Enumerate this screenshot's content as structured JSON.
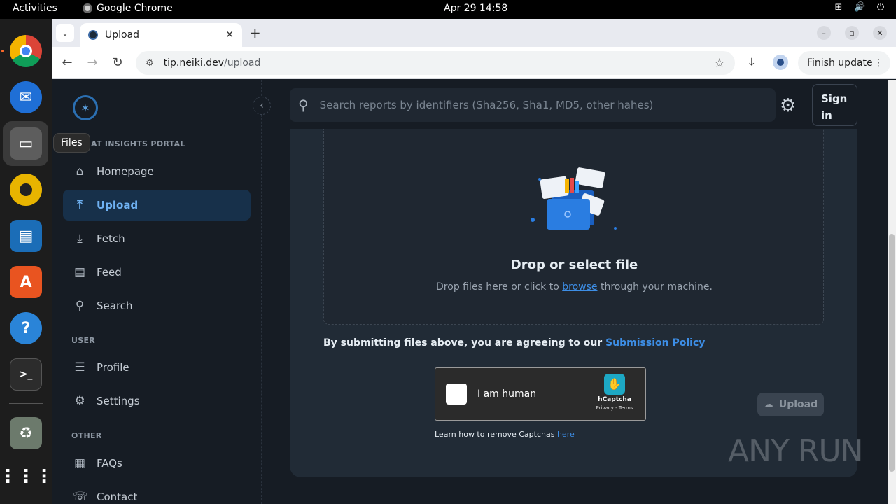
{
  "topbar": {
    "activities": "Activities",
    "app_name": "Google Chrome",
    "clock": "Apr 29  14:58"
  },
  "dock": {
    "items": [
      "chrome-icon",
      "thunderbird-icon",
      "files-icon",
      "rhythmbox-icon",
      "writer-icon",
      "app-center-icon",
      "help-icon",
      "terminal-icon",
      "trash-icon",
      "app-grid-icon"
    ],
    "tooltip": "Files"
  },
  "browser": {
    "tab_title": "Upload",
    "url_host": "tip.neiki.dev",
    "url_path": "/upload",
    "finish_update": "Finish update"
  },
  "sidebar": {
    "brand_label": "AT INSIGHTS PORTAL",
    "nav": [
      {
        "label": "Homepage",
        "icon": "home-icon"
      },
      {
        "label": "Upload",
        "icon": "upload-icon"
      },
      {
        "label": "Fetch",
        "icon": "fetch-icon"
      },
      {
        "label": "Feed",
        "icon": "feed-icon"
      },
      {
        "label": "Search",
        "icon": "search-icon"
      }
    ],
    "user_label": "USER",
    "user_nav": [
      {
        "label": "Profile",
        "icon": "profile-icon"
      },
      {
        "label": "Settings",
        "icon": "settings-icon"
      }
    ],
    "other_label": "OTHER",
    "other_nav": [
      {
        "label": "FAQs",
        "icon": "faq-icon"
      },
      {
        "label": "Contact",
        "icon": "contact-icon"
      }
    ]
  },
  "header": {
    "search_placeholder": "Search reports by identifiers (Sha256, Sha1, MD5, other hahes)",
    "sign_in": "Sign in"
  },
  "upload": {
    "drop_title": "Drop or select file",
    "drop_sub_before": "Drop files here or click to ",
    "drop_sub_link": "browse",
    "drop_sub_after": " through your machine.",
    "agreement_text": "By submitting files above, you are agreeing to our ",
    "agreement_link": "Submission Policy",
    "captcha_label": "I am human",
    "captcha_brand": "hCaptcha",
    "captcha_links": "Privacy - Terms",
    "captcha_help": "Learn how to remove Captchas ",
    "captcha_help_link": "here",
    "upload_button": "Upload"
  },
  "watermark": "ANY RUN"
}
